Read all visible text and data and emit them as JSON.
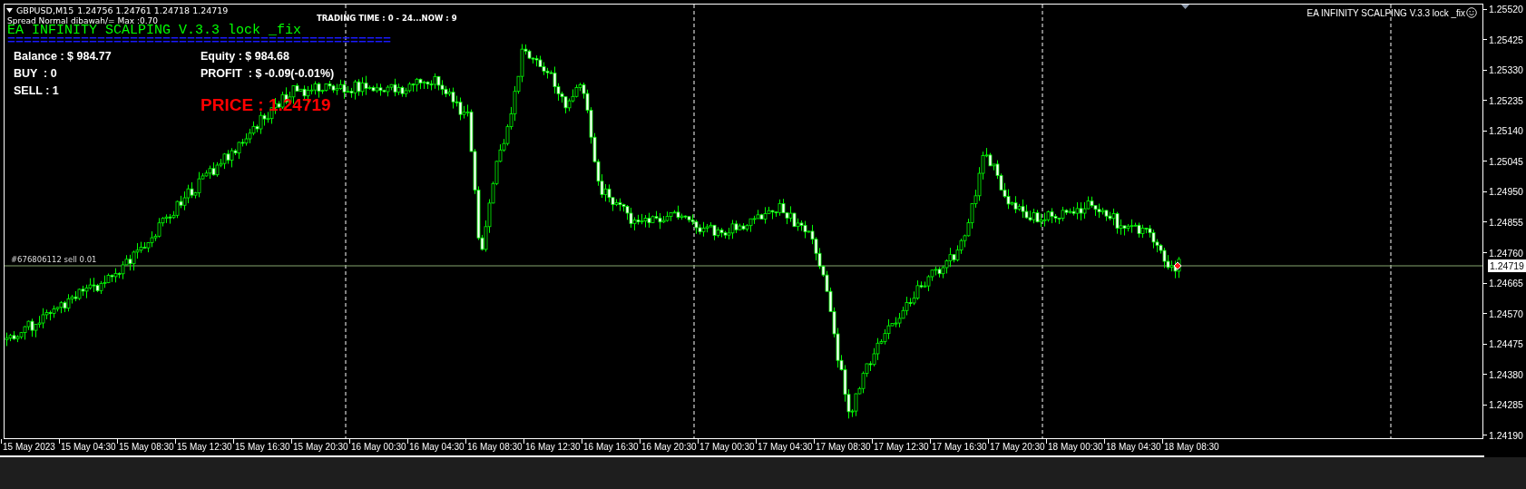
{
  "header": {
    "symbol": "GBPUSD,M15",
    "quotes": "1.24756 1.24761 1.24718 1.24719"
  },
  "spread_note": "Spread Normal dibawah/= Max :0.70",
  "trading_time": "TRADING TIME : 0 - 24...NOW : 9",
  "ea_title": "EA INFINITY SCALPING V.3.3 lock _fix",
  "separator": "===============================================",
  "stats": {
    "balance": "Balance : $ 984.77",
    "equity": "Equity : $ 984.68",
    "buy": "BUY  : 0",
    "profit": "PROFIT  : $ -0.09(-0.01%)",
    "sell": "SELL : 1"
  },
  "price_banner": "PRICE : 1.24719",
  "corner_label": "EA INFINITY SCALPING V.3.3 lock _fix",
  "order_label": "#676806112 sell 0.01",
  "price_axis": [
    "1.25520",
    "1.25425",
    "1.25330",
    "1.25235",
    "1.25140",
    "1.25045",
    "1.24950",
    "1.24855",
    "1.24760",
    "1.24665",
    "1.24570",
    "1.24475",
    "1.24380",
    "1.24285",
    "1.24190"
  ],
  "current_price": "1.24719",
  "time_axis": [
    "15 May 2023",
    "15 May 04:30",
    "15 May 08:30",
    "15 May 12:30",
    "15 May 16:30",
    "15 May 20:30",
    "16 May 00:30",
    "16 May 04:30",
    "16 May 08:30",
    "16 May 12:30",
    "16 May 16:30",
    "16 May 20:30",
    "17 May 00:30",
    "17 May 04:30",
    "17 May 08:30",
    "17 May 12:30",
    "17 May 16:30",
    "17 May 20:30",
    "18 May 00:30",
    "18 May 04:30",
    "18 May 08:30"
  ]
}
